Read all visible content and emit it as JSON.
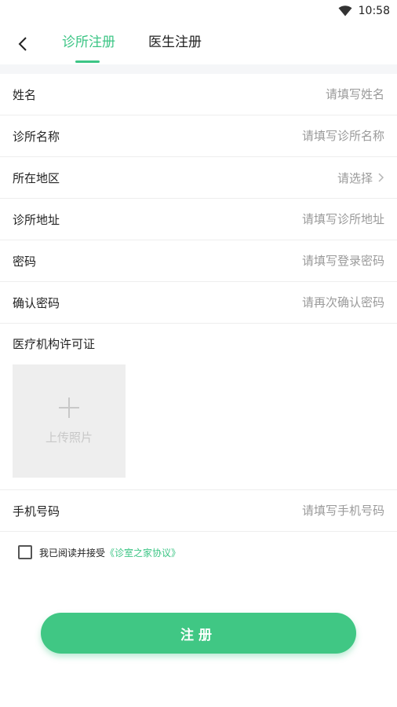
{
  "status_bar": {
    "time": "10:58",
    "wifi_icon": "wifi-icon"
  },
  "nav": {
    "back_icon": "chevron-left-icon",
    "tabs": [
      {
        "label": "诊所注册",
        "active": true
      },
      {
        "label": "医生注册",
        "active": false
      }
    ]
  },
  "form": {
    "name": {
      "label": "姓名",
      "placeholder": "请填写姓名"
    },
    "clinic_name": {
      "label": "诊所名称",
      "placeholder": "请填写诊所名称"
    },
    "region": {
      "label": "所在地区",
      "value": "请选择",
      "icon": "chevron-right-icon"
    },
    "clinic_address": {
      "label": "诊所地址",
      "placeholder": "请填写诊所地址"
    },
    "password": {
      "label": "密码",
      "placeholder": "请填写登录密码"
    },
    "confirm_password": {
      "label": "确认密码",
      "placeholder": "请再次确认密码"
    },
    "license": {
      "label": "医疗机构许可证",
      "upload_text": "上传照片",
      "upload_icon": "plus-icon"
    },
    "phone": {
      "label": "手机号码",
      "placeholder": "请填写手机号码"
    }
  },
  "agreement": {
    "checked": false,
    "text": "我已阅读并接受",
    "link": "《诊室之家协议》"
  },
  "register_button": {
    "label": "注册"
  },
  "colors": {
    "accent": "#3cc585",
    "placeholder": "#9a9a9a",
    "divider": "#eeeeee"
  }
}
